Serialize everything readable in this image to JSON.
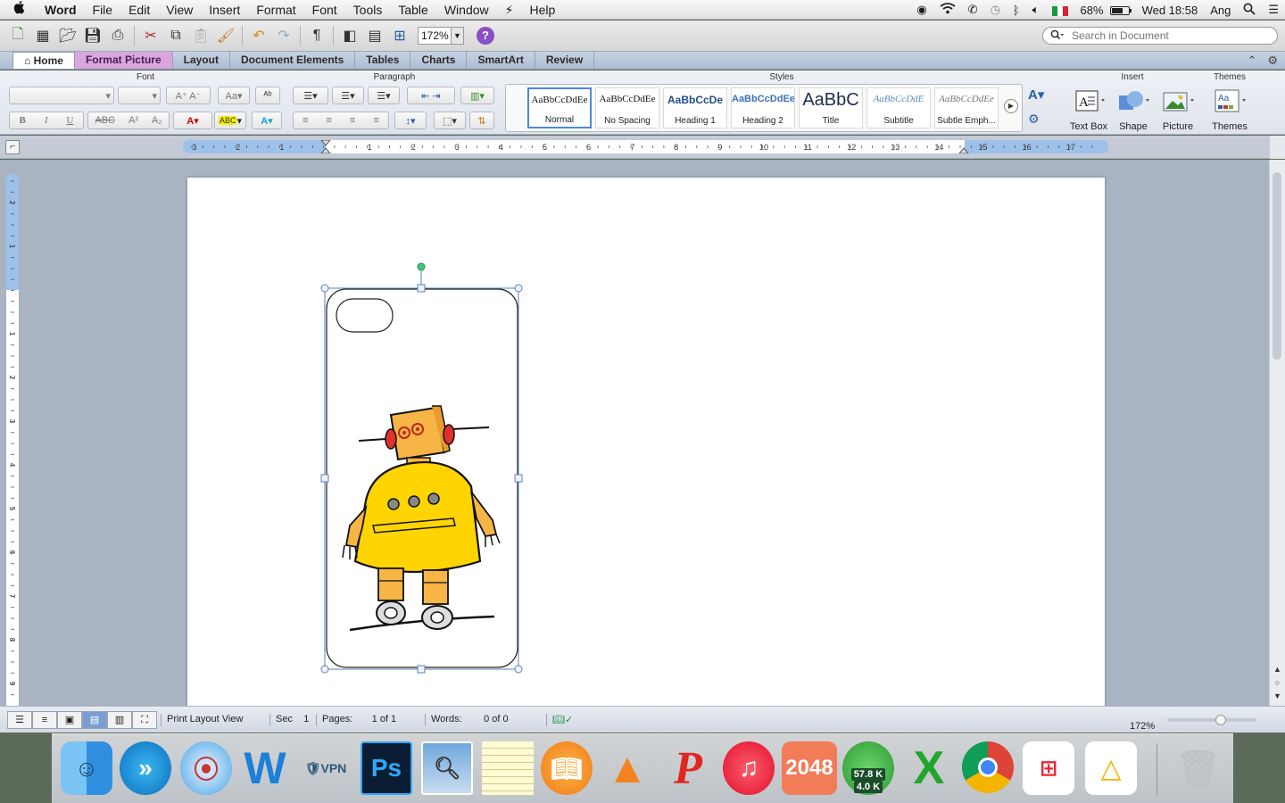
{
  "menubar": {
    "app_name": "Word",
    "items": [
      "File",
      "Edit",
      "View",
      "Insert",
      "Format",
      "Font",
      "Tools",
      "Table",
      "Window",
      "Help"
    ],
    "battery_percent": "68%",
    "battery_level": 0.68,
    "clock": "Wed 18:58",
    "user": "Ang"
  },
  "toolbar": {
    "zoom": "172%",
    "search_placeholder": "Search in Document"
  },
  "ribbon_tabs": {
    "home": "Home",
    "format_picture": "Format Picture",
    "layout": "Layout",
    "document_elements": "Document Elements",
    "tables": "Tables",
    "charts": "Charts",
    "smartart": "SmartArt",
    "review": "Review",
    "active": "Format Picture"
  },
  "ribbon_groups": {
    "font": "Font",
    "paragraph": "Paragraph",
    "styles": "Styles",
    "insert": "Insert",
    "themes": "Themes"
  },
  "styles": [
    {
      "sample": "AaBbCcDdEe",
      "name": "Normal"
    },
    {
      "sample": "AaBbCcDdEe",
      "name": "No Spacing"
    },
    {
      "sample": "AaBbCcDe",
      "name": "Heading 1"
    },
    {
      "sample": "AaBbCcDdEe",
      "name": "Heading 2"
    },
    {
      "sample": "AaBbC",
      "name": "Title"
    },
    {
      "sample": "AaBbCcDdE",
      "name": "Subtitle"
    },
    {
      "sample": "AaBbCcDdEe",
      "name": "Subtle Emph..."
    }
  ],
  "insert_buttons": {
    "text_box": "Text Box",
    "shape": "Shape",
    "picture": "Picture",
    "themes": "Themes"
  },
  "ruler": {
    "h_ticks": [
      "3",
      "2",
      "1",
      "1",
      "2",
      "3",
      "4",
      "5",
      "6",
      "7",
      "8",
      "9",
      "10",
      "11",
      "12",
      "13",
      "14",
      "15",
      "16",
      "17"
    ],
    "v_ticks": [
      "2",
      "1",
      "1",
      "2",
      "3",
      "4",
      "5",
      "6",
      "7",
      "8",
      "9"
    ]
  },
  "statusbar": {
    "view": "Print Layout View",
    "sec_label": "Sec",
    "sec_value": "1",
    "pages_label": "Pages:",
    "pages_value": "1 of 1",
    "words_label": "Words:",
    "words_value": "0 of 0",
    "zoom": "172%"
  },
  "dock": {
    "app_2048": "2048",
    "net_up": "57.8 K",
    "net_down": "4.0 K"
  },
  "colors": {
    "accent_tab": "#d9a6de",
    "robot_yellow": "#ffd400",
    "robot_orange": "#f6b545",
    "selection": "#5a82b8"
  }
}
